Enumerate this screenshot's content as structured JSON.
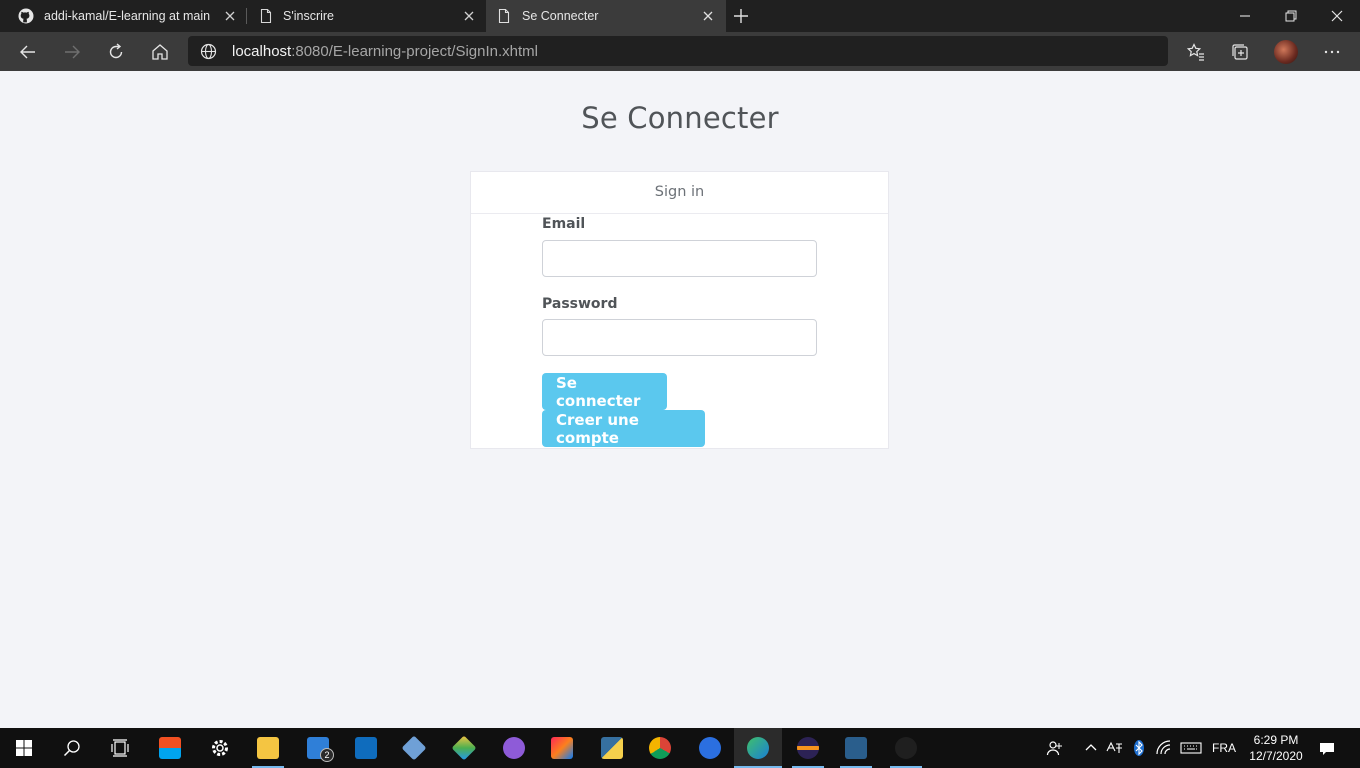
{
  "browser": {
    "tabs": [
      {
        "label": "addi-kamal/E-learning at main",
        "icon": "github-icon",
        "active": false
      },
      {
        "label": "S'inscrire",
        "icon": "page-icon",
        "active": false
      },
      {
        "label": "Se Connecter",
        "icon": "page-icon",
        "active": true
      }
    ],
    "address": {
      "host": "localhost",
      "path": ":8080/E-learning-project/SignIn.xhtml"
    }
  },
  "page": {
    "title": "Se Connecter",
    "card_header": "Sign in",
    "email_label": "Email",
    "email_value": "",
    "password_label": "Password",
    "password_value": "",
    "login_button": "Se connecter",
    "register_button": "Creer une compte"
  },
  "taskbar": {
    "mail_badge": "2",
    "language": "FRA",
    "time": "6:29 PM",
    "date": "12/7/2020"
  },
  "colors": {
    "button": "#5bc8ee",
    "page_bg": "#f3f4f8",
    "tabstrip_bg": "#202020",
    "navbar_bg": "#3b3b3b",
    "taskbar_bg": "#101010"
  }
}
